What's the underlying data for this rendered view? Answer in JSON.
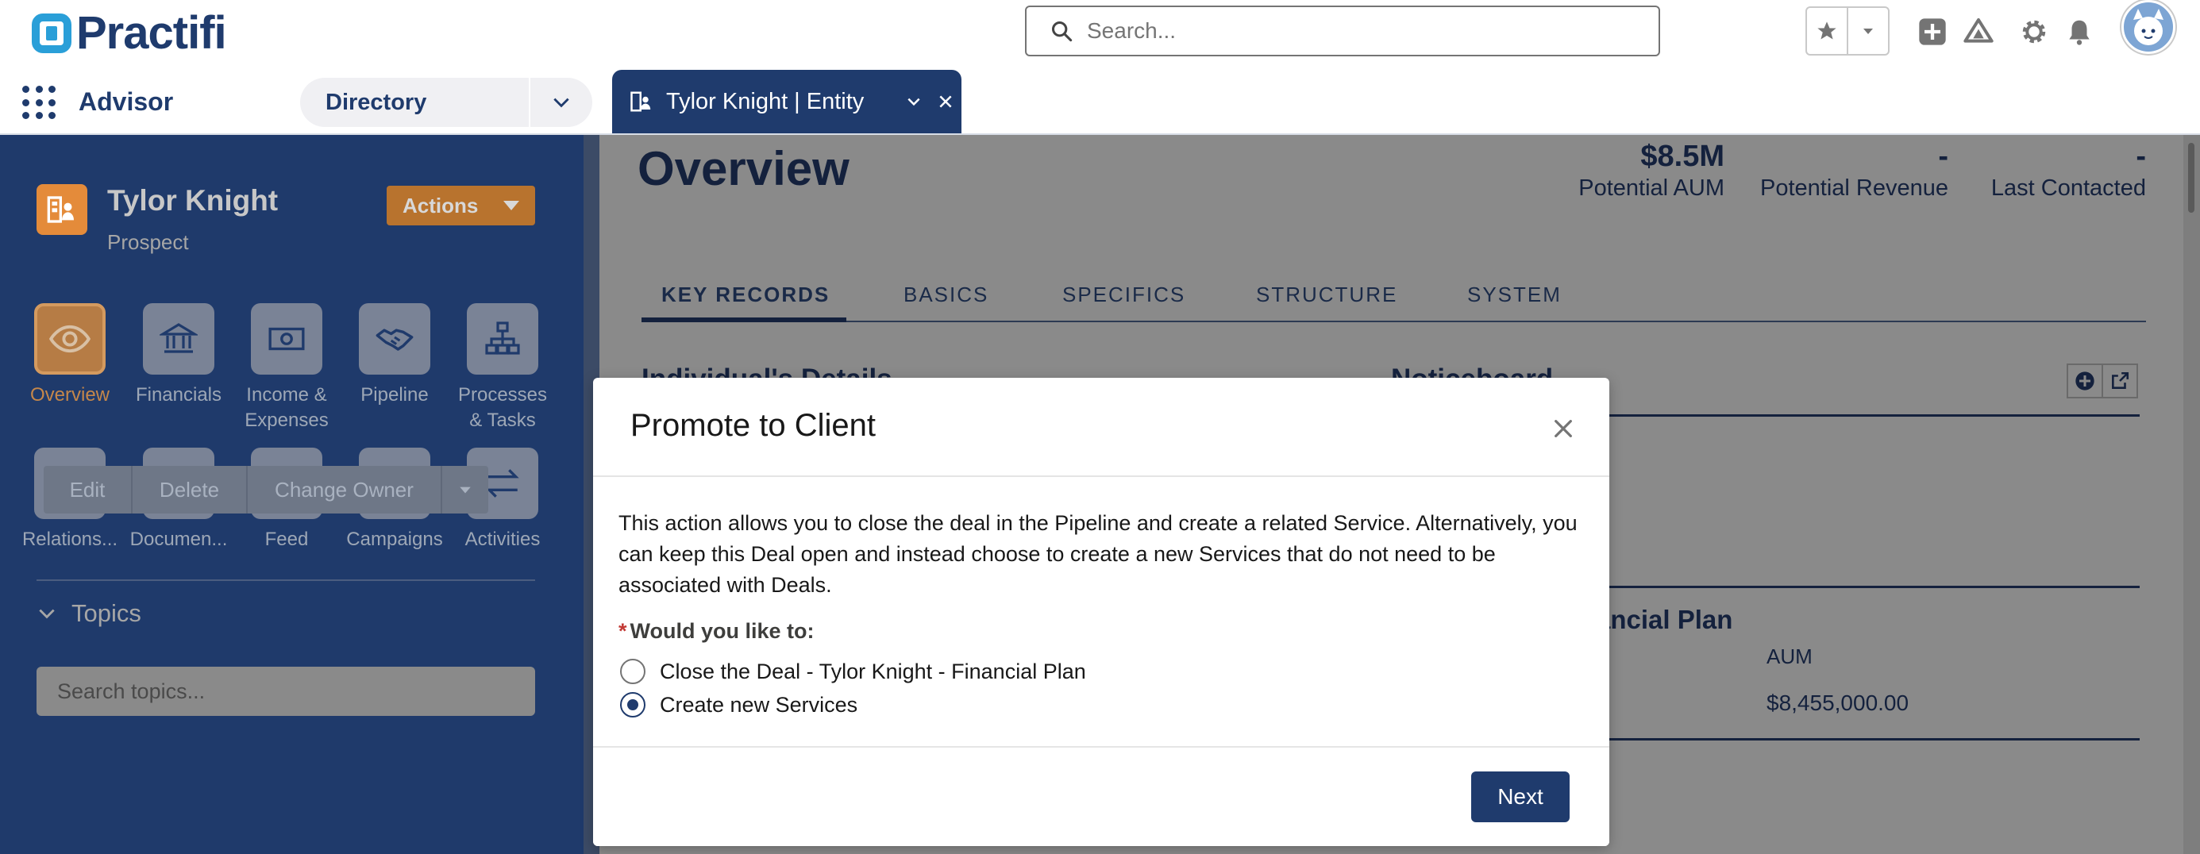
{
  "header": {
    "brand": "Practifi",
    "search_placeholder": "Search..."
  },
  "nav": {
    "app_name": "Advisor",
    "dropdown_label": "Directory",
    "open_tab": "Tylor Knight | Entity"
  },
  "record": {
    "name": "Tylor Knight",
    "type": "Prospect",
    "actions_label": "Actions",
    "tiles": [
      {
        "label": "Overview"
      },
      {
        "label": "Financials"
      },
      {
        "label": "Income &\nExpenses"
      },
      {
        "label": "Pipeline"
      },
      {
        "label": "Processes\n& Tasks"
      },
      {
        "label": "Relations..."
      },
      {
        "label": "Documen..."
      },
      {
        "label": "Feed"
      },
      {
        "label": "Campaigns"
      },
      {
        "label": "Activities"
      }
    ],
    "buttons": {
      "edit": "Edit",
      "delete": "Delete",
      "change_owner": "Change Owner"
    },
    "topics_label": "Topics",
    "topics_placeholder": "Search topics..."
  },
  "main": {
    "title": "Overview",
    "kpis": [
      {
        "value": "$8.5M",
        "label": "Potential AUM"
      },
      {
        "value": "-",
        "label": "Potential Revenue"
      },
      {
        "value": "-",
        "label": "Last Contacted"
      }
    ],
    "tabs": [
      "KEY RECORDS",
      "BASICS",
      "SPECIFICS",
      "STRUCTURE",
      "SYSTEM"
    ],
    "active_tab": "KEY RECORDS",
    "sections": {
      "left": "Individual's Details",
      "right": "Noticeboard"
    },
    "bg_plan_fragment": "ancial Plan",
    "aum_header": "AUM",
    "aum_value": "$8,455,000.00"
  },
  "modal": {
    "title": "Promote to Client",
    "description": "This action allows you to close the deal in the Pipeline and create a related Service. Alternatively, you can keep this Deal open and instead choose to create a new Services that do not need to be associated with Deals.",
    "question": "Would you like to:",
    "options": [
      {
        "label": "Close the Deal - Tylor Knight - Financial Plan",
        "checked": false
      },
      {
        "label": "Create new Services",
        "checked": true
      }
    ],
    "next_label": "Next"
  },
  "colors": {
    "brand_navy": "#1f3b6d",
    "accent_orange": "#e48b3a",
    "logo_blue": "#2a9fd8"
  }
}
